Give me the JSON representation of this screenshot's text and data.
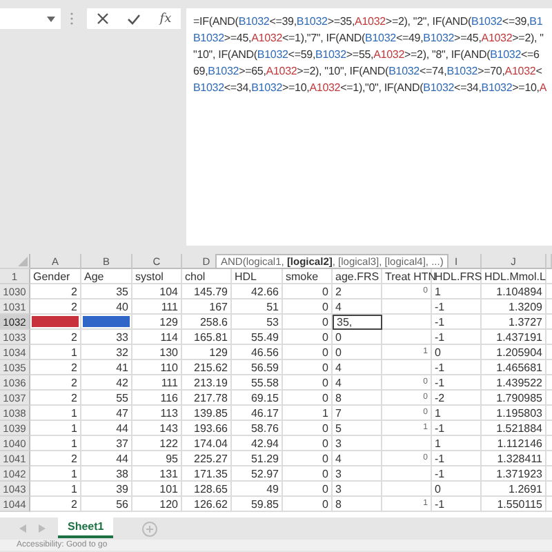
{
  "formula_bar": {
    "function_label": "fx",
    "lines": [
      [
        {
          "t": "=IF(AND(",
          "kind": "text"
        },
        {
          "t": "B1032",
          "kind": "ref_b"
        },
        {
          "t": "<=39,",
          "kind": "text"
        },
        {
          "t": "B1032",
          "kind": "ref_b"
        },
        {
          "t": ">=35,",
          "kind": "text"
        },
        {
          "t": "A1032",
          "kind": "ref_a"
        },
        {
          "t": ">=2), \"2\", IF(AND(",
          "kind": "text"
        },
        {
          "t": "B1032",
          "kind": "ref_b"
        },
        {
          "t": "<=39,",
          "kind": "text"
        },
        {
          "t": "B1",
          "kind": "ref_b"
        }
      ],
      [
        {
          "t": "B1032",
          "kind": "ref_b"
        },
        {
          "t": ">=45,",
          "kind": "text"
        },
        {
          "t": "A1032",
          "kind": "ref_a"
        },
        {
          "t": "<=1),\"7\", IF(AND(",
          "kind": "text"
        },
        {
          "t": "B1032",
          "kind": "ref_b"
        },
        {
          "t": "<=49,",
          "kind": "text"
        },
        {
          "t": "B1032",
          "kind": "ref_b"
        },
        {
          "t": ">=45,",
          "kind": "text"
        },
        {
          "t": "A1032",
          "kind": "ref_a"
        },
        {
          "t": ">=2), \"",
          "kind": "text"
        }
      ],
      [
        {
          "t": "\"10\", IF(AND(",
          "kind": "text"
        },
        {
          "t": "B1032",
          "kind": "ref_b"
        },
        {
          "t": "<=59,",
          "kind": "text"
        },
        {
          "t": "B1032",
          "kind": "ref_b"
        },
        {
          "t": ">=55,",
          "kind": "text"
        },
        {
          "t": "A1032",
          "kind": "ref_a"
        },
        {
          "t": ">=2), \"8\",  IF(AND(",
          "kind": "text"
        },
        {
          "t": "B1032",
          "kind": "ref_b"
        },
        {
          "t": "<=6",
          "kind": "text"
        }
      ],
      [
        {
          "t": "69,",
          "kind": "text"
        },
        {
          "t": "B1032",
          "kind": "ref_b"
        },
        {
          "t": ">=65,",
          "kind": "text"
        },
        {
          "t": "A1032",
          "kind": "ref_a"
        },
        {
          "t": ">=2), \"10\",  IF(AND(",
          "kind": "text"
        },
        {
          "t": "B1032",
          "kind": "ref_b"
        },
        {
          "t": "<=74,",
          "kind": "text"
        },
        {
          "t": "B1032",
          "kind": "ref_b"
        },
        {
          "t": ">=70,",
          "kind": "text"
        },
        {
          "t": "A1032",
          "kind": "ref_a"
        },
        {
          "t": "<",
          "kind": "text"
        }
      ],
      [
        {
          "t": "B1032",
          "kind": "ref_b"
        },
        {
          "t": "<=34,",
          "kind": "text"
        },
        {
          "t": "B1032",
          "kind": "ref_b"
        },
        {
          "t": ">=10,",
          "kind": "text"
        },
        {
          "t": "A1032",
          "kind": "ref_a"
        },
        {
          "t": "<=1),\"0\", IF(AND(",
          "kind": "text"
        },
        {
          "t": "B1032",
          "kind": "ref_b"
        },
        {
          "t": "<=34,",
          "kind": "text"
        },
        {
          "t": "B1032",
          "kind": "ref_b"
        },
        {
          "t": ">=10,",
          "kind": "text"
        },
        {
          "t": "A",
          "kind": "ref_a"
        }
      ]
    ]
  },
  "tooltip": "AND(logical1, **[logical2]**, [logical3], [logical4], ...)",
  "sheet": {
    "columns": [
      {
        "letter": "A",
        "heading": "Gender",
        "left_aligned": false
      },
      {
        "letter": "B",
        "heading": "Age",
        "left_aligned": false
      },
      {
        "letter": "C",
        "heading": "systol",
        "left_aligned": false
      },
      {
        "letter": "D",
        "heading": "chol",
        "left_aligned": false
      },
      {
        "heading": "HDL",
        "left_aligned": false
      },
      {
        "heading": "smoke",
        "left_aligned": false
      },
      {
        "heading": "age.FRS",
        "left_aligned": true
      },
      {
        "heading": "Treat HTN",
        "left_aligned": false
      },
      {
        "letter": "I",
        "heading": "HDL.FRS",
        "left_aligned": true
      },
      {
        "letter": "J",
        "heading": "HDL.Mmol.L",
        "left_aligned": false
      }
    ],
    "rows": [
      {
        "num": "1030",
        "selected": false,
        "cells": [
          {
            "v": "2"
          },
          {
            "v": "35"
          },
          {
            "v": "104"
          },
          {
            "v": "145.79"
          },
          {
            "v": "42.66"
          },
          {
            "v": "0"
          },
          {
            "v": "2"
          },
          {
            "v": "0"
          },
          {
            "v": "1"
          },
          {
            "v": "1.104894"
          }
        ]
      },
      {
        "num": "1031",
        "selected": false,
        "cells": [
          {
            "v": "2"
          },
          {
            "v": "40"
          },
          {
            "v": "111"
          },
          {
            "v": "167"
          },
          {
            "v": "51"
          },
          {
            "v": "0"
          },
          {
            "v": "4"
          },
          null,
          {
            "v": "-1"
          },
          {
            "v": "1.3209"
          }
        ]
      },
      {
        "num": "1032",
        "selected": true,
        "cells": [
          {
            "color": "#c8323c"
          },
          {
            "color": "#2f66c8"
          },
          {
            "v": "129"
          },
          {
            "v": "258.6"
          },
          {
            "v": "53"
          },
          {
            "v": "0"
          },
          {
            "v": "35,",
            "active": true
          },
          null,
          {
            "v": "-1"
          },
          {
            "v": "1.3727"
          }
        ]
      },
      {
        "num": "1033",
        "selected": false,
        "cells": [
          {
            "v": "2"
          },
          {
            "v": "33"
          },
          {
            "v": "114"
          },
          {
            "v": "165.81"
          },
          {
            "v": "55.49"
          },
          {
            "v": "0"
          },
          {
            "v": "0"
          },
          null,
          {
            "v": "-1"
          },
          {
            "v": "1.437191"
          }
        ]
      },
      {
        "num": "1034",
        "selected": false,
        "cells": [
          {
            "v": "1"
          },
          {
            "v": "32"
          },
          {
            "v": "130"
          },
          {
            "v": "129"
          },
          {
            "v": "46.56"
          },
          {
            "v": "0"
          },
          {
            "v": "0"
          },
          {
            "v": "1"
          },
          {
            "v": "0"
          },
          {
            "v": "1.205904"
          }
        ]
      },
      {
        "num": "1035",
        "selected": false,
        "cells": [
          {
            "v": "2"
          },
          {
            "v": "41"
          },
          {
            "v": "110"
          },
          {
            "v": "215.62"
          },
          {
            "v": "56.59"
          },
          {
            "v": "0"
          },
          {
            "v": "4"
          },
          null,
          {
            "v": "-1"
          },
          {
            "v": "1.465681"
          }
        ]
      },
      {
        "num": "1036",
        "selected": false,
        "cells": [
          {
            "v": "2"
          },
          {
            "v": "42"
          },
          {
            "v": "111"
          },
          {
            "v": "213.19"
          },
          {
            "v": "55.58"
          },
          {
            "v": "0"
          },
          {
            "v": "4"
          },
          {
            "v": "0"
          },
          {
            "v": "-1"
          },
          {
            "v": "1.439522"
          }
        ]
      },
      {
        "num": "1037",
        "selected": false,
        "cells": [
          {
            "v": "2"
          },
          {
            "v": "55"
          },
          {
            "v": "116"
          },
          {
            "v": "217.78"
          },
          {
            "v": "69.15"
          },
          {
            "v": "0"
          },
          {
            "v": "8"
          },
          {
            "v": "0"
          },
          {
            "v": "-2"
          },
          {
            "v": "1.790985"
          }
        ]
      },
      {
        "num": "1038",
        "selected": false,
        "cells": [
          {
            "v": "1"
          },
          {
            "v": "47"
          },
          {
            "v": "113"
          },
          {
            "v": "139.85"
          },
          {
            "v": "46.17"
          },
          {
            "v": "1"
          },
          {
            "v": "7"
          },
          {
            "v": "0"
          },
          {
            "v": "1"
          },
          {
            "v": "1.195803"
          }
        ]
      },
      {
        "num": "1039",
        "selected": false,
        "cells": [
          {
            "v": "1"
          },
          {
            "v": "44"
          },
          {
            "v": "143"
          },
          {
            "v": "193.66"
          },
          {
            "v": "58.76"
          },
          {
            "v": "0"
          },
          {
            "v": "5"
          },
          {
            "v": "1"
          },
          {
            "v": "-1"
          },
          {
            "v": "1.521884"
          }
        ]
      },
      {
        "num": "1040",
        "selected": false,
        "cells": [
          {
            "v": "1"
          },
          {
            "v": "37"
          },
          {
            "v": "122"
          },
          {
            "v": "174.04"
          },
          {
            "v": "42.94"
          },
          {
            "v": "0"
          },
          {
            "v": "3"
          },
          null,
          {
            "v": "1"
          },
          {
            "v": "1.112146"
          }
        ]
      },
      {
        "num": "1041",
        "selected": false,
        "cells": [
          {
            "v": "2"
          },
          {
            "v": "44"
          },
          {
            "v": "95"
          },
          {
            "v": "225.27"
          },
          {
            "v": "51.29"
          },
          {
            "v": "0"
          },
          {
            "v": "4"
          },
          {
            "v": "0"
          },
          {
            "v": "-1"
          },
          {
            "v": "1.328411"
          }
        ]
      },
      {
        "num": "1042",
        "selected": false,
        "cells": [
          {
            "v": "1"
          },
          {
            "v": "38"
          },
          {
            "v": "131"
          },
          {
            "v": "171.35"
          },
          {
            "v": "52.97"
          },
          {
            "v": "0"
          },
          {
            "v": "3"
          },
          null,
          {
            "v": "-1"
          },
          {
            "v": "1.371923"
          }
        ]
      },
      {
        "num": "1043",
        "selected": false,
        "cells": [
          {
            "v": "1"
          },
          {
            "v": "39"
          },
          {
            "v": "101"
          },
          {
            "v": "128.65"
          },
          {
            "v": "49"
          },
          {
            "v": "0"
          },
          {
            "v": "3"
          },
          null,
          {
            "v": "0"
          },
          {
            "v": "1.2691"
          }
        ]
      },
      {
        "num": "1044",
        "selected": false,
        "cells": [
          {
            "v": "2"
          },
          {
            "v": "56"
          },
          {
            "v": "120"
          },
          {
            "v": "126.62"
          },
          {
            "v": "59.85"
          },
          {
            "v": "0"
          },
          {
            "v": "8"
          },
          {
            "v": "1"
          },
          {
            "v": "-1"
          },
          {
            "v": "1.550115"
          }
        ]
      }
    ],
    "header_row_num": "1"
  },
  "sheet_tabs": [
    {
      "label": "Sheet1",
      "selected": true
    }
  ],
  "status_bar": "Accessibility: Good to go"
}
